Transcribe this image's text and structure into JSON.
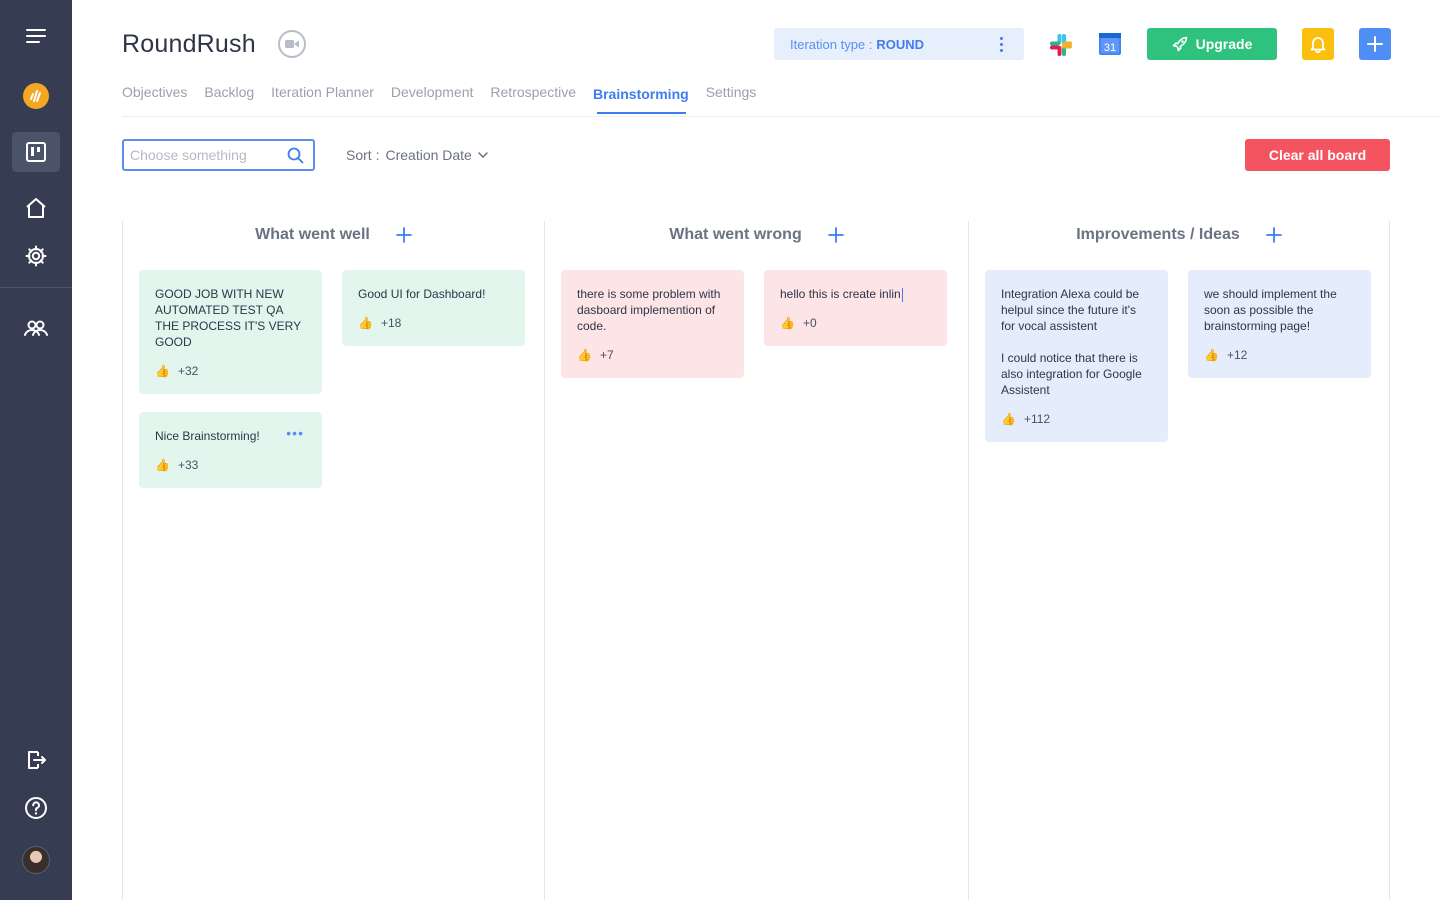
{
  "app": {
    "title": "RoundRush"
  },
  "header": {
    "iteration_label": "Iteration type :",
    "iteration_value": "ROUND",
    "calendar_day": "31",
    "upgrade_label": "Upgrade"
  },
  "tabs": [
    {
      "label": "Objectives"
    },
    {
      "label": "Backlog"
    },
    {
      "label": "Iteration Planner"
    },
    {
      "label": "Development"
    },
    {
      "label": "Retrospective"
    },
    {
      "label": "Brainstorming",
      "active": true
    },
    {
      "label": "Settings"
    }
  ],
  "toolbar": {
    "search_placeholder": "Choose something",
    "sort_label": "Sort :",
    "sort_value": "Creation Date",
    "clear_label": "Clear all board"
  },
  "columns": [
    {
      "title": "What went well"
    },
    {
      "title": "What went wrong"
    },
    {
      "title": "Improvements / Ideas"
    }
  ],
  "cards": {
    "well_1": {
      "text": "GOOD JOB WITH NEW AUTOMATED TEST QA THE PROCESS IT'S VERY GOOD",
      "likes": "+32"
    },
    "well_2": {
      "text": "Good UI for Dashboard!",
      "likes": "+18"
    },
    "well_3": {
      "text": "Nice Brainstorming!",
      "likes": "+33"
    },
    "wrong_1": {
      "text": "there is some problem with dasboard implemention of code.",
      "likes": "+7"
    },
    "wrong_2": {
      "text": "hello this is create inlin",
      "likes": "+0"
    },
    "ideas_1": {
      "text": "Integration Alexa could be helpul since the future it's for vocal assistent\n\nI could notice that there is also integration for Google Assistent",
      "likes": "+112"
    },
    "ideas_2": {
      "text": "we should implement the soon as possible the brainstorming page!",
      "likes": "+12"
    }
  },
  "colors": {
    "sidebar": "#363d52",
    "accent": "#3f7cf0",
    "upgrade": "#2ec27e",
    "danger": "#f4545f",
    "bell": "#fbbf0d",
    "card_green": "#e2f6ee",
    "card_red": "#fde4e6",
    "card_blue": "#e5edfd"
  }
}
